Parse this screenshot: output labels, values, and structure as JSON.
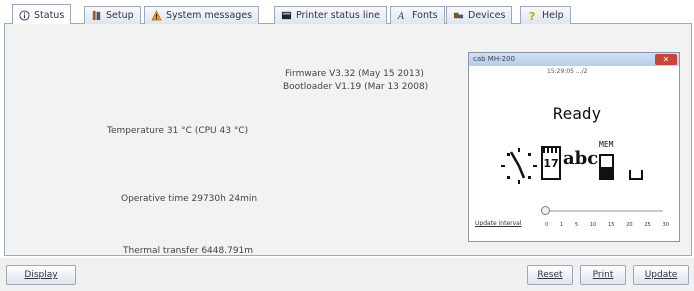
{
  "tabs": [
    {
      "label": "Status",
      "icon": "info-icon"
    },
    {
      "label": "Setup",
      "icon": "tools-icon"
    },
    {
      "label": "System messages",
      "icon": "warning-icon"
    },
    {
      "label": "Printer status line",
      "icon": "display-icon"
    },
    {
      "label": "Fonts",
      "icon": "font-icon"
    },
    {
      "label": "Devices",
      "icon": "devices-icon"
    },
    {
      "label": "Help",
      "icon": "help-icon"
    }
  ],
  "status": {
    "firmware": "Firmware V3.32 (May 15 2013)",
    "bootloader": "Bootloader V1.19 (Mar 13 2008)",
    "temperature": "Temperature 31 °C (CPU 43 °C)",
    "operative_time": "Operative time 29730h 24min",
    "thermal_transfer": "Thermal transfer 6448.791m"
  },
  "display_window": {
    "title": "cab MH-200",
    "header": "15:29:05 .../2",
    "status_text": "Ready",
    "date_day": "17",
    "abc_text": "abc",
    "mem_text": "MEM",
    "close_glyph": "✕",
    "update_interval_label": "Update interval",
    "slider_ticks": [
      "0",
      "1",
      "5",
      "10",
      "15",
      "20",
      "25",
      "30"
    ],
    "slider_value": 0
  },
  "buttons": {
    "display": "Display",
    "reset": "Reset",
    "print": "Print",
    "update": "Update"
  }
}
